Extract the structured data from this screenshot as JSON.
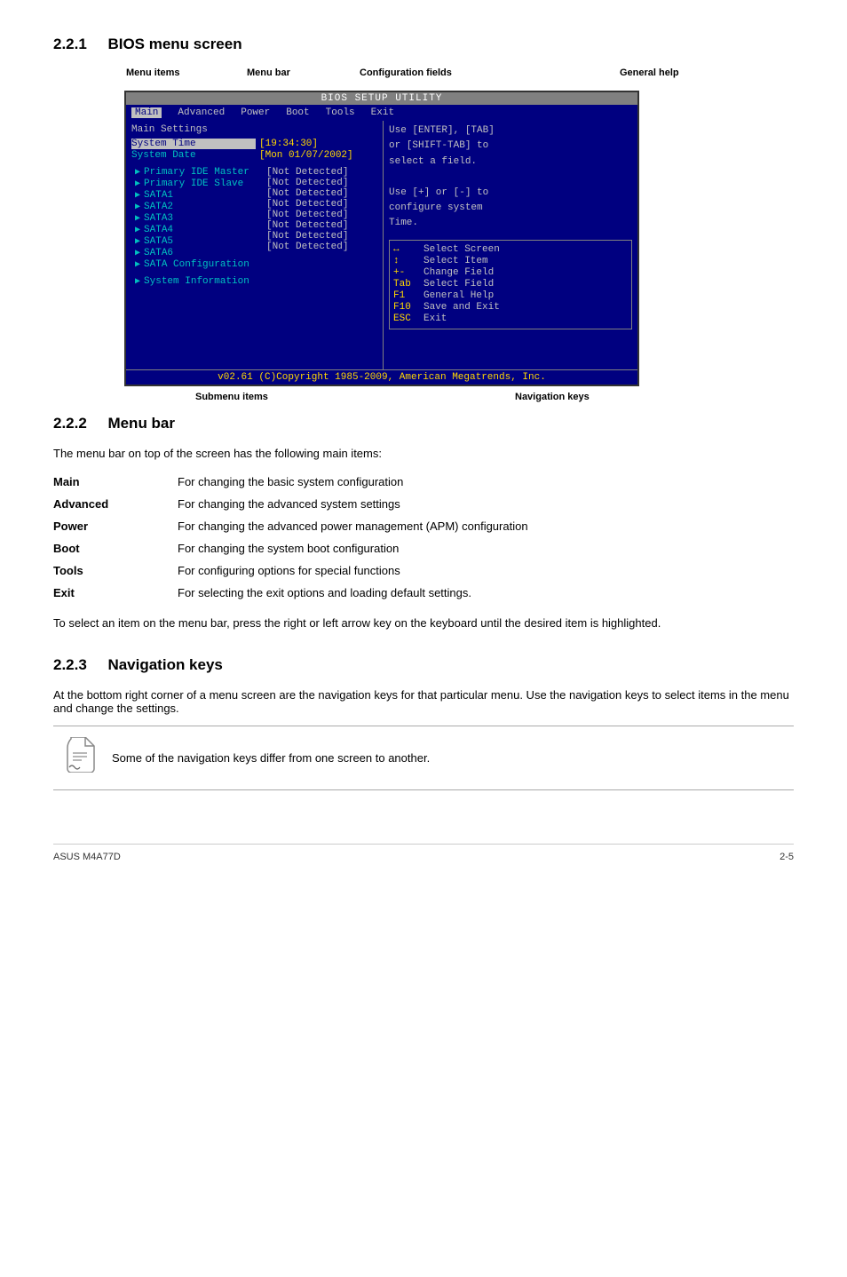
{
  "page": {
    "section_221": {
      "number": "2.2.1",
      "title": "BIOS menu screen"
    },
    "section_222": {
      "number": "2.2.2",
      "title": "Menu bar",
      "intro": "The menu bar on top of the screen has the following main items:",
      "items": [
        {
          "label": "Main",
          "description": "For changing the basic system configuration"
        },
        {
          "label": "Advanced",
          "description": "For changing the advanced system settings"
        },
        {
          "label": "Power",
          "description": "For changing the advanced power management (APM) configuration"
        },
        {
          "label": "Boot",
          "description": "For changing the system boot configuration"
        },
        {
          "label": "Tools",
          "description": "For configuring options for special functions"
        },
        {
          "label": "Exit",
          "description": "For selecting the exit options and loading default settings."
        }
      ],
      "note": "To select an item on the menu bar, press the right or left arrow key on the keyboard until the desired item is highlighted."
    },
    "section_223": {
      "number": "2.2.3",
      "title": "Navigation keys",
      "intro": "At the bottom right corner of a menu screen are the navigation keys for that particular menu. Use the navigation keys to select items in the menu and change the settings."
    },
    "note_box": {
      "text": "Some of the navigation keys differ from one screen to another."
    },
    "footer": {
      "left": "ASUS M4A77D",
      "right": "2-5"
    }
  },
  "diagram": {
    "labels": {
      "menu_items": "Menu items",
      "menu_bar": "Menu bar",
      "config_fields": "Configuration fields",
      "general_help": "General help",
      "submenu_items": "Submenu items",
      "navigation_keys": "Navigation keys"
    },
    "bios": {
      "title": "BIOS SETUP UTILITY",
      "menu_items": [
        "Main",
        "Advanced",
        "Power",
        "Boot",
        "Tools",
        "Exit"
      ],
      "active_menu": "Main",
      "section_title": "Main Settings",
      "fields": [
        {
          "label": "System Time",
          "value": "[19:34:30]",
          "highlighted": true
        },
        {
          "label": "System Date",
          "value": "[Mon 01/07/2002]",
          "highlighted": false
        }
      ],
      "items": [
        {
          "name": "Primary IDE Master",
          "value": "[Not Detected]"
        },
        {
          "name": "Primary IDE Slave",
          "value": "[Not Detected]"
        },
        {
          "name": "SATA1",
          "value": "[Not Detected]"
        },
        {
          "name": "SATA2",
          "value": "[Not Detected]"
        },
        {
          "name": "SATA3",
          "value": "[Not Detected]"
        },
        {
          "name": "SATA4",
          "value": "[Not Detected]"
        },
        {
          "name": "SATA5",
          "value": "[Not Detected]"
        },
        {
          "name": "SATA6",
          "value": "[Not Detected]"
        },
        {
          "name": "SATA Configuration",
          "value": ""
        },
        {
          "name": "System Information",
          "value": ""
        }
      ],
      "help_lines": [
        "Use [ENTER], [TAB]",
        "or [SHIFT-TAB] to",
        "select a field.",
        "",
        "Use [+] or [-] to",
        "configure system",
        "Time."
      ],
      "nav_keys": [
        {
          "key": "↔",
          "action": "Select Screen"
        },
        {
          "key": "↕",
          "action": "Select Item"
        },
        {
          "key": "+-",
          "action": "Change Field"
        },
        {
          "key": "Tab",
          "action": "Select Field"
        },
        {
          "key": "F1",
          "action": "General Help"
        },
        {
          "key": "F10",
          "action": "Save and Exit"
        },
        {
          "key": "ESC",
          "action": "Exit"
        }
      ],
      "footer": "v02.61  (C)Copyright 1985-2009, American Megatrends, Inc."
    }
  }
}
